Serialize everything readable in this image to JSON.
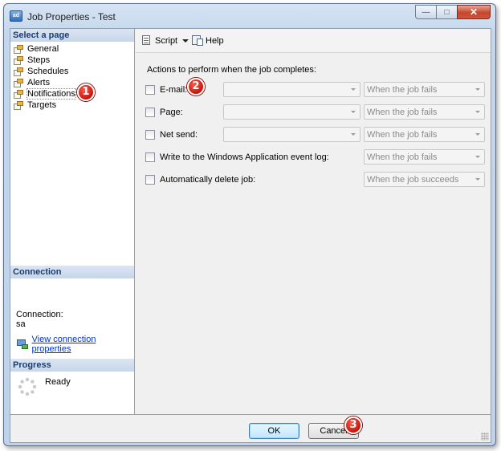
{
  "window": {
    "title": "Job Properties - Test",
    "icon": "sql-agent-job-icon",
    "controls": {
      "minimize": "—",
      "maximize": "□",
      "close": "✕"
    }
  },
  "left_panel": {
    "select_page_header": "Select a page",
    "pages": [
      {
        "label": "General"
      },
      {
        "label": "Steps"
      },
      {
        "label": "Schedules"
      },
      {
        "label": "Alerts"
      },
      {
        "label": "Notifications",
        "selected": true
      },
      {
        "label": "Targets"
      }
    ],
    "connection_header": "Connection",
    "connection_label": "Connection:",
    "connection_value": "sa",
    "connection_link": "View connection properties",
    "progress_header": "Progress",
    "progress_status": "Ready"
  },
  "toolbar": {
    "script_label": "Script",
    "help_label": "Help"
  },
  "main": {
    "actions_label": "Actions to perform when the job completes:",
    "rows": [
      {
        "label": "E-mail:",
        "operator": "",
        "condition": "When the job fails",
        "checked": false
      },
      {
        "label": "Page:",
        "operator": "",
        "condition": "When the job fails",
        "checked": false
      },
      {
        "label": "Net send:",
        "operator": "",
        "condition": "When the job fails",
        "checked": false
      },
      {
        "label": "Write to the Windows Application event log:",
        "condition": "When the job fails",
        "checked": false
      },
      {
        "label": "Automatically delete job:",
        "condition": "When the job succeeds",
        "checked": false
      }
    ]
  },
  "buttons": {
    "ok": "OK",
    "cancel": "Cancel"
  },
  "callouts": {
    "one": "1",
    "two": "2",
    "three": "3",
    "color": "#d0160c"
  }
}
